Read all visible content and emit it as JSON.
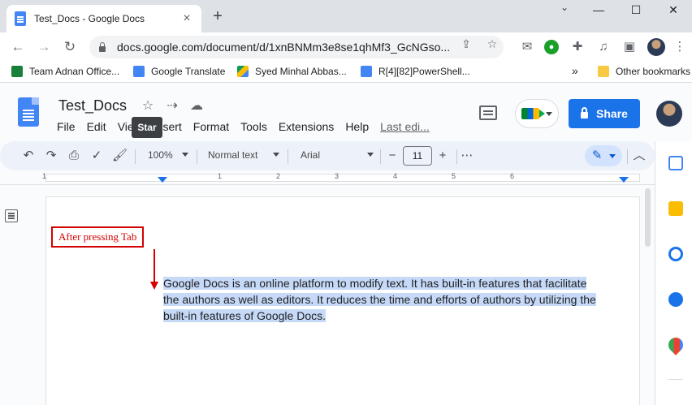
{
  "browser": {
    "tab_title": "Test_Docs - Google Docs",
    "tab_close": "×",
    "new_tab": "+",
    "url": "docs.google.com/document/d/1xnBNMm3e8se1qhMf3_GcNGso...",
    "window_controls": {
      "minimize": "—",
      "maximize": "☐",
      "close": "✕"
    }
  },
  "bookmarks": [
    {
      "label": "Team Adnan Office...",
      "color": "#188038"
    },
    {
      "label": "Google Translate",
      "color": "#4285f4"
    },
    {
      "label": "Syed Minhal Abbas...",
      "color": "#fbbc04"
    },
    {
      "label": "R[4][82]PowerShell...",
      "color": "#4285f4"
    }
  ],
  "bookmarks_more": "»",
  "bookmarks_other": "Other bookmarks",
  "docs": {
    "title": "Test_Docs",
    "menu": [
      "File",
      "Edit",
      "View",
      "Insert",
      "Format",
      "Tools",
      "Extensions",
      "Help"
    ],
    "last_edit": "Last edi...",
    "tooltip": "Star",
    "share_label": "Share"
  },
  "toolbar": {
    "zoom": "100%",
    "style": "Normal text",
    "font": "Arial",
    "font_size": "11",
    "minus": "−",
    "plus": "+",
    "more": "⋯"
  },
  "ruler": {
    "numbers": [
      "1",
      "1",
      "2",
      "3",
      "4",
      "5",
      "6"
    ]
  },
  "annotation": {
    "label": "After pressing Tab"
  },
  "document": {
    "lines": [
      "Google Docs is an online platform to modify text. It has built-in features that facilitate",
      "the authors as well as editors. It reduces the time and efforts of authors by utilizing the",
      "built-in features of Google Docs."
    ]
  },
  "colors": {
    "accent": "#1a73e8",
    "highlight": "#c6daf8",
    "annotation": "#d40000"
  }
}
